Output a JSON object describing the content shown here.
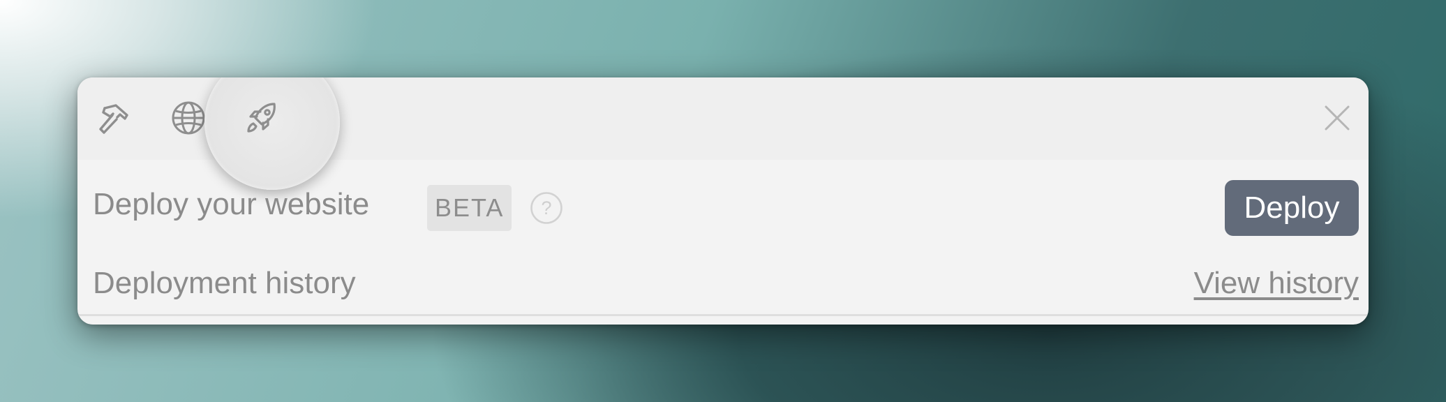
{
  "toolbar": {
    "tools": [
      {
        "name": "build",
        "icon": "hammer-icon"
      },
      {
        "name": "publish",
        "icon": "globe-icon"
      },
      {
        "name": "deploy",
        "icon": "rocket-icon",
        "selected": true
      }
    ],
    "close_icon": "close-icon"
  },
  "deploy": {
    "label": "Deploy your website",
    "badge": "BETA",
    "help_icon": "question-circle-icon",
    "button_label": "Deploy"
  },
  "history": {
    "label": "Deployment history",
    "link_label": "View history"
  },
  "colors": {
    "panel_bg": "#f3f3f3",
    "toolbar_bg": "#efefef",
    "button_bg": "#626b7a",
    "text_muted": "#8b8b8b"
  }
}
